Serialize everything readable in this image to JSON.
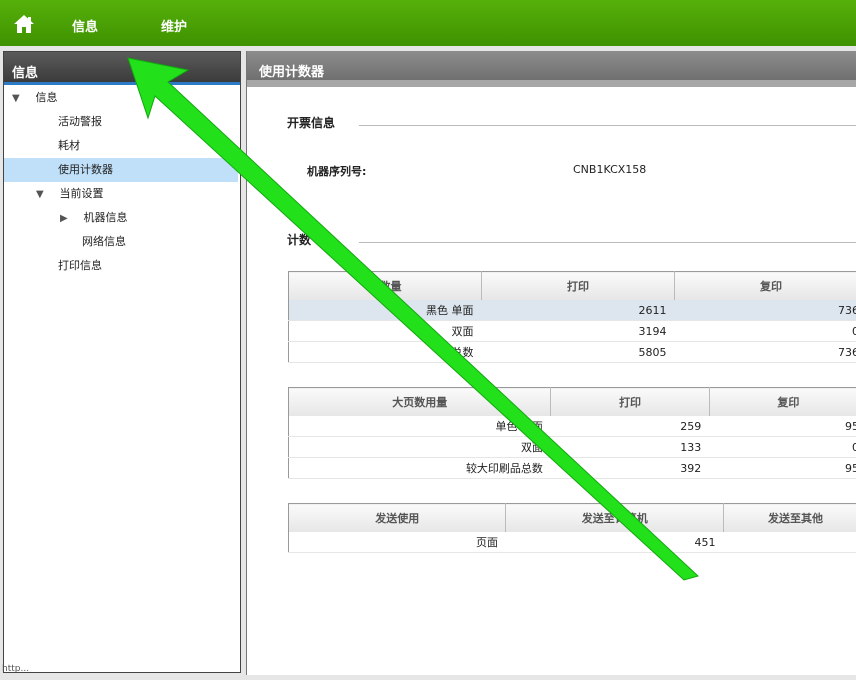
{
  "nav": {
    "home_icon": "home-icon",
    "items": [
      "信息",
      "维护"
    ]
  },
  "sidebar": {
    "title": "信息",
    "items": [
      {
        "label": "信息",
        "expanded": true
      },
      {
        "label": "活动警报"
      },
      {
        "label": "耗材"
      },
      {
        "label": "使用计数器",
        "selected": true
      },
      {
        "label": "当前设置",
        "expanded": true
      },
      {
        "label": "机器信息",
        "collapsed": true
      },
      {
        "label": "网络信息"
      },
      {
        "label": "打印信息"
      }
    ]
  },
  "main": {
    "title": "使用计数器",
    "billing": {
      "title": "开票信息",
      "serial_label": "机器序列号:",
      "serial_value": "CNB1KCX158"
    },
    "counters_title": "计数",
    "total_table": {
      "headers": [
        "总数量",
        "打印",
        "复印"
      ],
      "rows": [
        {
          "label": "黑色 单面",
          "print": "2611",
          "copy": "736"
        },
        {
          "label": "双面",
          "print": "3194",
          "copy": "0"
        },
        {
          "label": "总数",
          "print": "5805",
          "copy": "736"
        }
      ]
    },
    "large_table": {
      "headers": [
        "大页数用量",
        "打印",
        "复印"
      ],
      "rows": [
        {
          "label": "单色 单面",
          "print": "259",
          "copy": "95"
        },
        {
          "label": "双面",
          "print": "133",
          "copy": "0"
        },
        {
          "label": "较大印刷品总数",
          "print": "392",
          "copy": "95"
        }
      ]
    },
    "send_table": {
      "headers": [
        "发送使用",
        "发送至计算机",
        "发送至其他"
      ],
      "rows": [
        {
          "label": "页面",
          "value": "451"
        }
      ]
    }
  },
  "statusbar": {
    "text": "http..."
  },
  "colors": {
    "topbar": "#4aa405",
    "arrow": "#22e01a",
    "selected": "#bfe0f8"
  }
}
